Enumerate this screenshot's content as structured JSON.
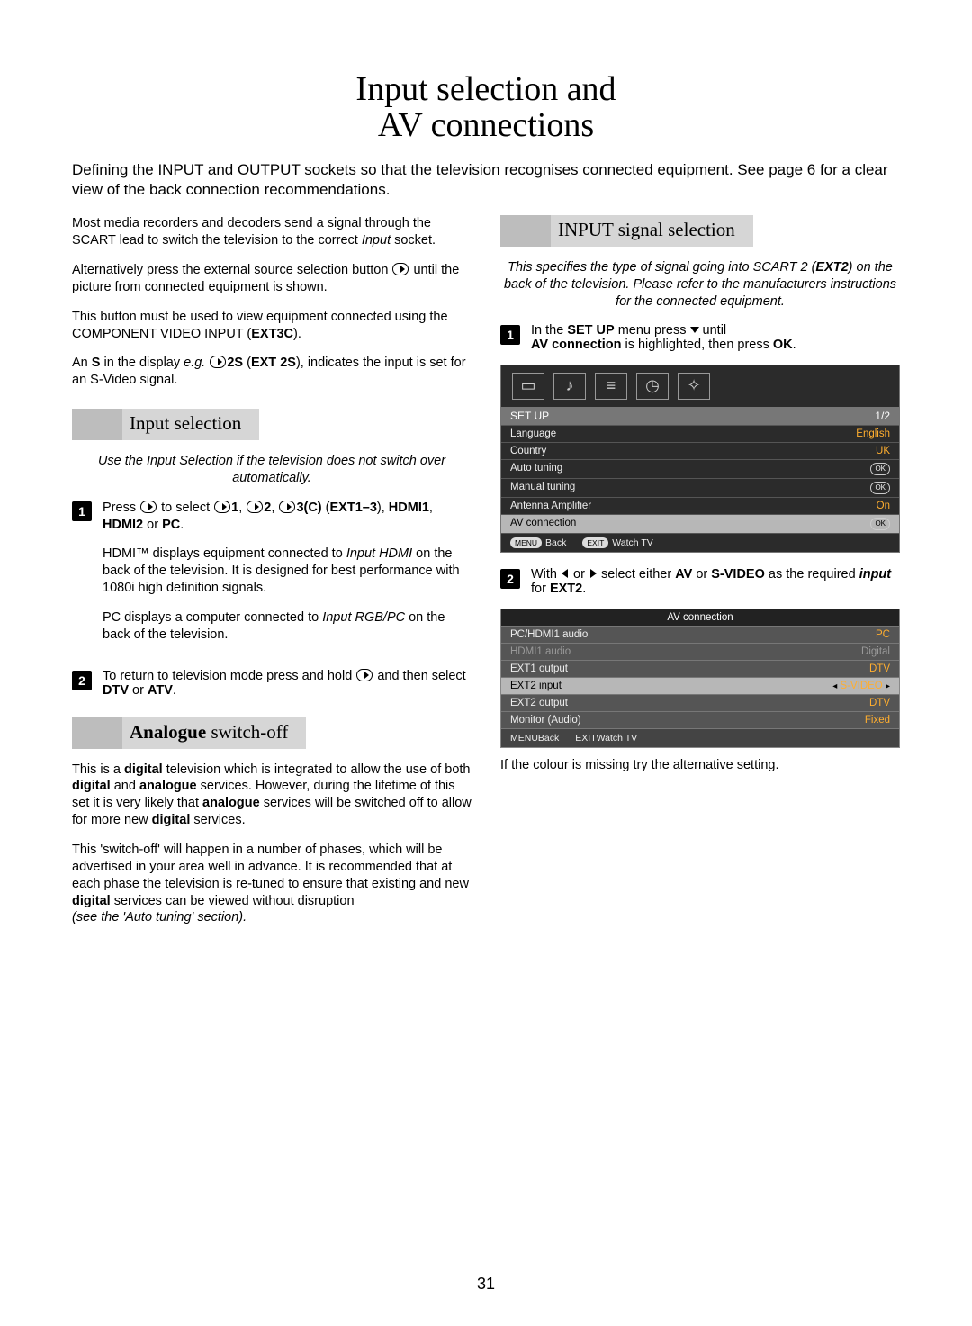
{
  "page_number": "31",
  "title_line1": "Input selection and",
  "title_line2": "AV connections",
  "intro": "Defining the INPUT and OUTPUT sockets so that the television recognises connected equipment. See page 6 for a clear view of the back connection recommendations.",
  "left": {
    "p1a": "Most media recorders and decoders send a signal through the SCART lead to switch the television to the correct ",
    "p1b_em": "Input",
    "p1c": " socket.",
    "p2a": "Alternatively press the external source selection button ",
    "p2b": " until the picture from connected equipment is shown.",
    "p3a": "This button must be used to view equipment connected using the COMPONENT VIDEO INPUT (",
    "p3b_bold": "EXT3C",
    "p3c": ").",
    "p4a": "An ",
    "p4b_bold": "S",
    "p4c": " in the display ",
    "p4d_em": "e.g.",
    "p4e": " ",
    "p4f_bold": "2S",
    "p4g": " (",
    "p4h_bold": "EXT 2S",
    "p4i": "), indicates the input is set for an S-Video signal.",
    "sec1": "Input selection",
    "s1_note_em": "Use the Input Selection if the television does not switch over automatically.",
    "s1_1a": "Press ",
    "s1_1b": " to select ",
    "s1_1_x1": "1",
    "s1_1_c1": ", ",
    "s1_1_x2": "2",
    "s1_1_c2": ", ",
    "s1_1_x3": "3(C)",
    "s1_1_c3": " (",
    "s1_1_b1": "EXT1–3",
    "s1_1_c4": "), ",
    "s1_1_b2": "HDMI1",
    "s1_1_c5": ", ",
    "s1_1_b3": "HDMI2",
    "s1_1_c6": " or ",
    "s1_1_b4": "PC",
    "s1_1_c7": ".",
    "s1_p2a": "HDMI™ displays equipment connected to ",
    "s1_p2b_em": "Input HDMI",
    "s1_p2c": " on the back of the television. It is designed for best performance with 1080i high definition signals.",
    "s1_p3a": "PC displays a computer connected to ",
    "s1_p3b_em": "Input RGB/PC",
    "s1_p3c": " on the back of the television.",
    "s1_2a": "To return to television mode press and hold ",
    "s1_2b": " and then select ",
    "s1_2c_bold": "DTV",
    "s1_2d": " or ",
    "s1_2e_bold": "ATV",
    "s1_2f": ".",
    "sec2_bold": "Analogue",
    "sec2_rest": " switch-off",
    "aso_p1a": "This is a ",
    "aso_p1b_bold": "digital",
    "aso_p1c": " television which is integrated to allow the use of both ",
    "aso_p1d_bold": "digital",
    "aso_p1e": " and ",
    "aso_p1f_bold": "analogue",
    "aso_p1g": " services. However, during the lifetime of this set it is very likely that ",
    "aso_p1h_bold": "analogue",
    "aso_p1i": " services will be switched off to allow for more new ",
    "aso_p1j_bold": "digital",
    "aso_p1k": " services.",
    "aso_p2a": "This 'switch-off' will happen in a number of phases, which will be advertised in your area well in advance. It is recommended that at each phase the television is re-tuned to ensure that existing and new ",
    "aso_p2b_bold": "digital",
    "aso_p2c": " services can be viewed without disruption",
    "aso_p2d_em": "(see the ",
    "aso_p2e": "'Auto tuning' ",
    "aso_p2f_em": "section)."
  },
  "right": {
    "sec": "INPUT signal selection",
    "note_em": "This specifies the type of signal going into SCART 2 (",
    "note_bold_em": "EXT2",
    "note_em2": ") on the back of the television. Please refer to the manufacturers instructions for the connected equipment.",
    "st1a": "In the ",
    "st1b_bold": "SET UP",
    "st1c": " menu press ",
    "st1d": " until ",
    "st1e_bold": "AV connection",
    "st1f": " is highlighted, then press ",
    "st1g_bold": "OK",
    "st1h": ".",
    "osd": {
      "title": "SET UP",
      "page": "1/2",
      "rows": [
        {
          "label": "Language",
          "value": "English",
          "hl": false
        },
        {
          "label": "Country",
          "value": "UK",
          "hl": false
        },
        {
          "label": "Auto tuning",
          "value": "OK",
          "ok": true
        },
        {
          "label": "Manual tuning",
          "value": "OK",
          "ok": true
        },
        {
          "label": "Antenna Amplifier",
          "value": "On",
          "hl": false
        },
        {
          "label": "AV connection",
          "value": "OK",
          "ok": true,
          "highlight": true
        }
      ],
      "foot_back": "Back",
      "foot_watch": "Watch TV",
      "pill_menu": "MENU",
      "pill_exit": "EXIT"
    },
    "st2a": "With ",
    "st2b": " or ",
    "st2c": " select either ",
    "st2d_bold": "AV",
    "st2e": " or ",
    "st2f_bold": "S-VIDEO",
    "st2g": " as the required ",
    "st2h_boldem": "input",
    "st2i": " for ",
    "st2j_bold": "EXT2",
    "st2k": ".",
    "osd2": {
      "title": "AV connection",
      "rows": [
        {
          "label": "PC/HDMI1 audio",
          "value": "PC"
        },
        {
          "label": "HDMI1 audio",
          "value": "Digital",
          "disabled": true
        },
        {
          "label": "EXT1 output",
          "value": "DTV"
        },
        {
          "label": "EXT2 input",
          "value": "S-VIDEO",
          "highlight": true,
          "arrows": true
        },
        {
          "label": "EXT2 output",
          "value": "DTV"
        },
        {
          "label": "Monitor (Audio)",
          "value": "Fixed"
        }
      ],
      "foot_back": "Back",
      "foot_watch": "Watch TV",
      "pill_menu": "MENU",
      "pill_exit": "EXIT"
    },
    "tail": "If the colour is missing try the alternative setting."
  }
}
